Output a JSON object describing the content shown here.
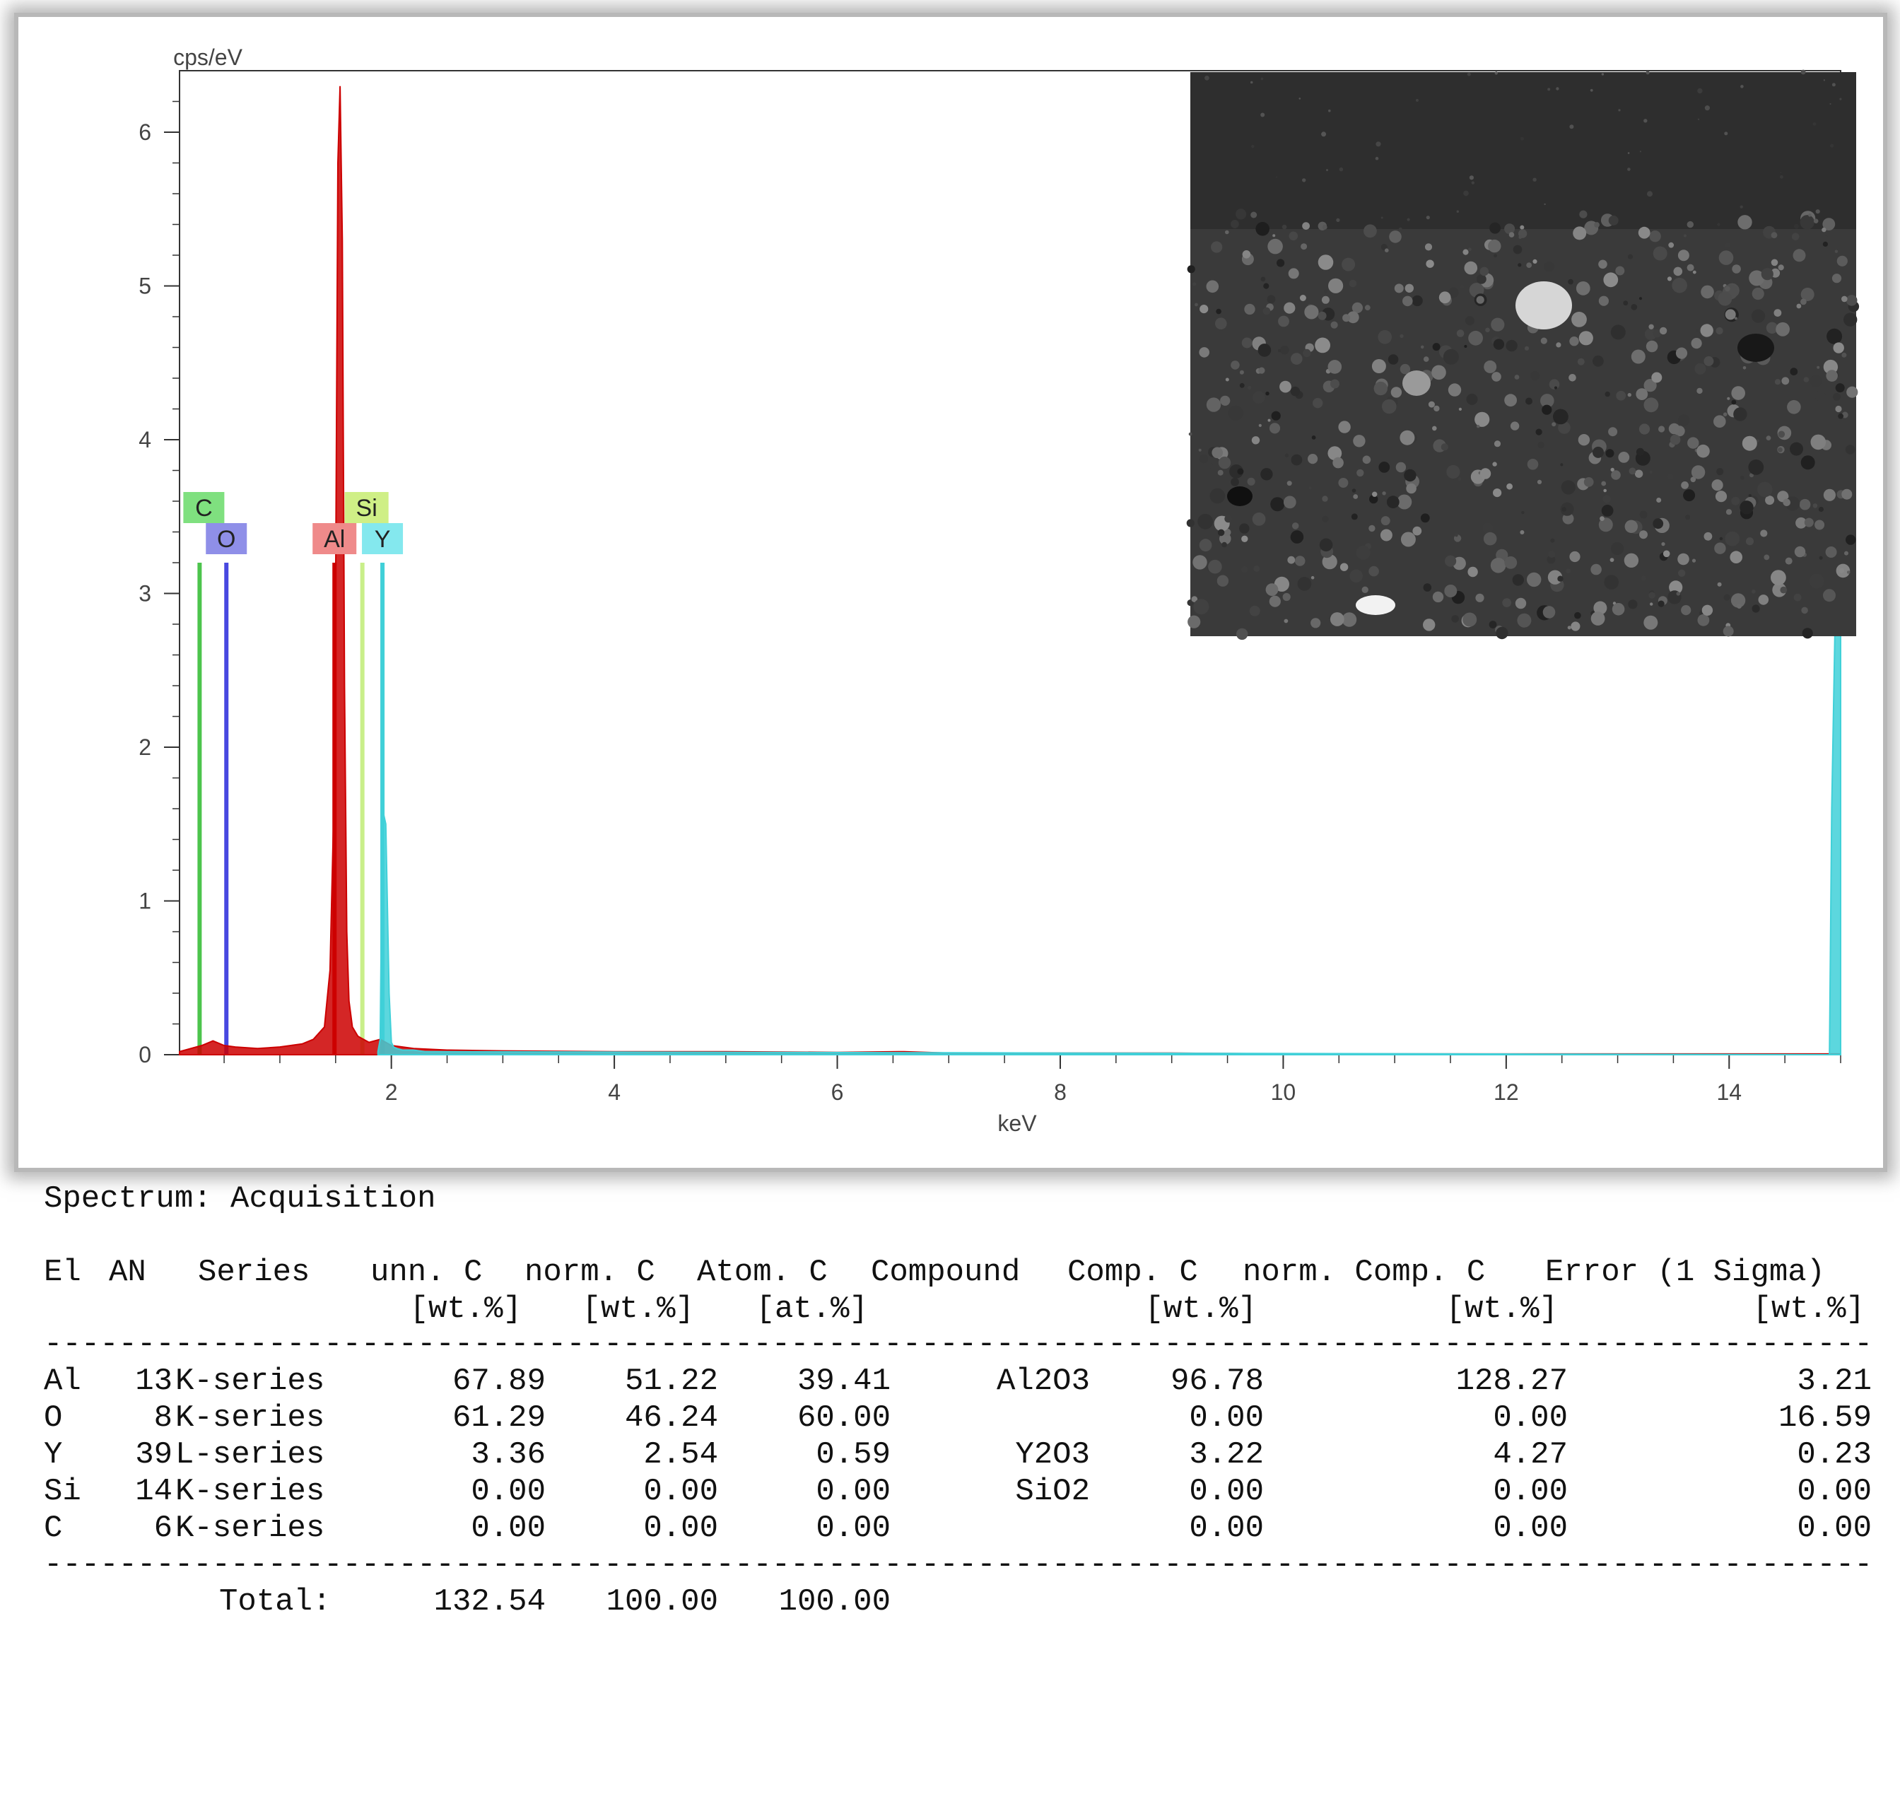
{
  "chart_data": {
    "type": "line",
    "title": "",
    "xlabel": "keV",
    "ylabel": "cps/eV",
    "xlim": [
      0.1,
      15.0
    ],
    "ylim": [
      0,
      6.4
    ],
    "x_ticks": [
      2,
      4,
      6,
      8,
      10,
      12,
      14
    ],
    "y_ticks": [
      0,
      1,
      2,
      3,
      4,
      5,
      6
    ],
    "grid": false,
    "series": [
      {
        "color": "#cc0000",
        "x": [
          0.1,
          0.3,
          0.4,
          0.5,
          0.6,
          0.8,
          1.0,
          1.2,
          1.3,
          1.4,
          1.45,
          1.48,
          1.5,
          1.52,
          1.54,
          1.56,
          1.58,
          1.6,
          1.62,
          1.65,
          1.7,
          1.8,
          1.9,
          2.0,
          2.2,
          2.5,
          3.0,
          4.0,
          5.0,
          6.0,
          6.6,
          7.0,
          8.0,
          9.0,
          10.0,
          12.0,
          14.0,
          15.0
        ],
        "y": [
          0.02,
          0.06,
          0.09,
          0.06,
          0.05,
          0.04,
          0.05,
          0.07,
          0.1,
          0.18,
          0.55,
          1.5,
          3.0,
          5.8,
          6.3,
          5.3,
          2.4,
          0.8,
          0.35,
          0.18,
          0.12,
          0.08,
          0.1,
          0.06,
          0.04,
          0.03,
          0.025,
          0.02,
          0.02,
          0.015,
          0.02,
          0.01,
          0.01,
          0.01,
          0.005,
          0.005,
          0.005,
          0.005
        ]
      },
      {
        "color": "#40d0d8",
        "x": [
          1.88,
          1.9,
          1.92,
          1.95,
          1.98,
          2.0,
          2.02,
          2.05,
          2.1,
          2.2,
          2.3,
          14.9,
          14.92,
          14.95,
          14.97,
          15.0
        ],
        "y": [
          0.02,
          0.1,
          1.6,
          1.5,
          0.4,
          0.08,
          0.05,
          0.04,
          0.03,
          0.03,
          0.02,
          0.0,
          1.6,
          2.8,
          2.8,
          2.8
        ]
      }
    ],
    "element_markers": [
      {
        "label": "C",
        "x": 0.28,
        "height": 3.2,
        "color": "#4cc44c",
        "box": "#7fe07f",
        "row": "upper"
      },
      {
        "label": "O",
        "x": 0.52,
        "height": 3.2,
        "color": "#4848e0",
        "box": "#8f8fe8",
        "row": "lower"
      },
      {
        "label": "Al",
        "x": 1.49,
        "height": 3.2,
        "color": "#cc0000",
        "box": "#ef8a8a",
        "row": "lower"
      },
      {
        "label": "Si",
        "x": 1.74,
        "height": 3.2,
        "color": "#c9ef8a",
        "box": "#cfef86",
        "row": "upper"
      },
      {
        "label": "Y",
        "x": 1.92,
        "height": 3.2,
        "color": "#40d0d8",
        "box": "#84e8ee",
        "row": "lower"
      }
    ]
  },
  "report": {
    "spectrum_line": "Spectrum: Acquisition",
    "headers": {
      "el": "El",
      "an": "AN",
      "series": "Series",
      "unn_c": "unn. C",
      "norm_c": "norm. C",
      "atom_c": "Atom. C",
      "compound": "Compound",
      "comp_c": "Comp. C",
      "norm_comp_c": "norm. Comp. C",
      "error": "Error (1 Sigma)"
    },
    "units": {
      "unn_c": "[wt.%]",
      "norm_c": "[wt.%]",
      "atom_c": "[at.%]",
      "comp_c": "[wt.%]",
      "norm_comp_c": "[wt.%]",
      "error": "[wt.%]"
    },
    "rows": [
      {
        "el": "Al",
        "an": "13",
        "series": "K-series",
        "unn_c": "67.89",
        "norm_c": "51.22",
        "atom_c": "39.41",
        "compound": "Al2O3",
        "comp_c": "96.78",
        "norm_comp_c": "128.27",
        "error": "3.21"
      },
      {
        "el": "O",
        "an": "8",
        "series": "K-series",
        "unn_c": "61.29",
        "norm_c": "46.24",
        "atom_c": "60.00",
        "compound": "",
        "comp_c": "0.00",
        "norm_comp_c": "0.00",
        "error": "16.59"
      },
      {
        "el": "Y",
        "an": "39",
        "series": "L-series",
        "unn_c": "3.36",
        "norm_c": "2.54",
        "atom_c": "0.59",
        "compound": "Y2O3",
        "comp_c": "3.22",
        "norm_comp_c": "4.27",
        "error": "0.23"
      },
      {
        "el": "Si",
        "an": "14",
        "series": "K-series",
        "unn_c": "0.00",
        "norm_c": "0.00",
        "atom_c": "0.00",
        "compound": "SiO2",
        "comp_c": "0.00",
        "norm_comp_c": "0.00",
        "error": "0.00"
      },
      {
        "el": "C",
        "an": "6",
        "series": "K-series",
        "unn_c": "0.00",
        "norm_c": "0.00",
        "atom_c": "0.00",
        "compound": "",
        "comp_c": "0.00",
        "norm_comp_c": "0.00",
        "error": "0.00"
      }
    ],
    "total": {
      "label": "Total:",
      "unn_c": "132.54",
      "norm_c": "100.00",
      "atom_c": "100.00"
    }
  }
}
